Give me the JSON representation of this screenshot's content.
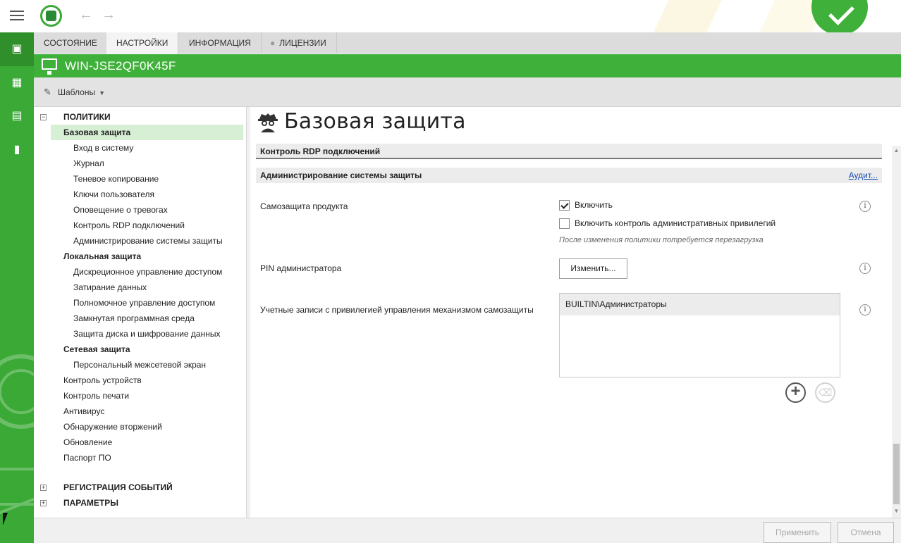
{
  "tabs": {
    "status": "СОСТОЯНИЕ",
    "settings": "НАСТРОЙКИ",
    "info": "ИНФОРМАЦИЯ",
    "licenses": "ЛИЦЕНЗИИ"
  },
  "host": {
    "name": "WIN-JSE2QF0K45F"
  },
  "toolbar": {
    "templates": "Шаблоны"
  },
  "tree": {
    "policies": "ПОЛИТИКИ",
    "basic_protection": "Базовая защита",
    "login": "Вход в систему",
    "journal": "Журнал",
    "shadow_copy": "Теневое копирование",
    "user_keys": "Ключи пользователя",
    "alarm_notify": "Оповещение о тревогах",
    "rdp_control": "Контроль RDP подключений",
    "security_admin": "Администрирование системы защиты",
    "local_protection": "Локальная защита",
    "discretionary": "Дискреционное управление доступом",
    "data_wipe": "Затирание данных",
    "mandatory": "Полномочное управление доступом",
    "closed_env": "Замкнутая программная среда",
    "disk_encryption": "Защита диска и шифрование данных",
    "network_protection": "Сетевая защита",
    "firewall": "Персональный межсетевой экран",
    "device_control": "Контроль устройств",
    "print_control": "Контроль печати",
    "antivirus": "Антивирус",
    "intrusion": "Обнаружение вторжений",
    "update": "Обновление",
    "software_passport": "Паспорт ПО",
    "event_registration": "РЕГИСТРАЦИЯ СОБЫТИЙ",
    "parameters": "ПАРАМЕТРЫ"
  },
  "main": {
    "title": "Базовая защита",
    "section_rdp": "Контроль RDP подключений",
    "section_admin": "Администрирование системы защиты",
    "audit_link": "Аудит...",
    "self_protection_label": "Самозащита продукта",
    "enable_label": "Включить",
    "enable_checked": true,
    "admin_priv_label": "Включить контроль административных привилегий",
    "admin_priv_checked": false,
    "reboot_note": "После изменения политики потребуется перезагрузка",
    "pin_label": "PIN администратора",
    "change_button": "Изменить...",
    "accounts_label": "Учетные записи с привилегией управления механизмом самозащиты",
    "accounts": [
      "BUILTIN\\Администраторы"
    ]
  },
  "footer": {
    "apply": "Применить",
    "cancel": "Отмена"
  },
  "colors": {
    "accent": "#3fb13a",
    "rail": "#3aa935",
    "selection": "#d7f0d5",
    "link": "#1a4fb5"
  },
  "icons": {
    "menu": "hamburger-icon",
    "logo": "app-logo-icon",
    "back": "arrow-left-icon",
    "forward": "arrow-right-icon",
    "status_ok": "checkmark-icon",
    "monitor": "monitor-icon",
    "pencil": "pencil-icon",
    "lock": "lock-icon",
    "spy": "spy-icon",
    "info": "info-icon",
    "add": "plus-circle-icon",
    "delete": "trash-icon"
  }
}
